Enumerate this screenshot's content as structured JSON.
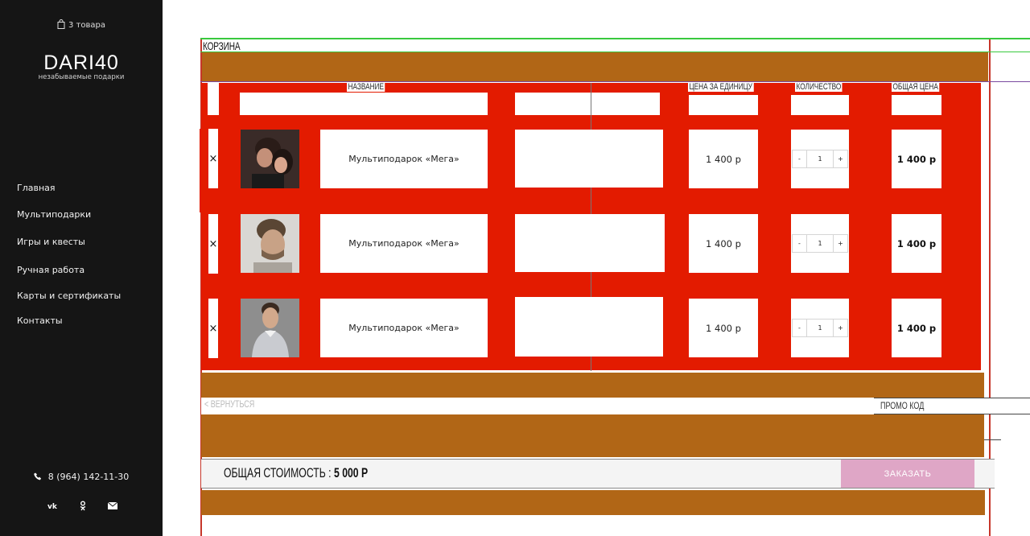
{
  "sidebar": {
    "cart_count": "3 товара",
    "logo": "DARI40",
    "tagline": "незабываемые подарки",
    "nav": [
      {
        "label": "Главная"
      },
      {
        "label": "Мультиподарки"
      },
      {
        "label": "Игры и квесты"
      },
      {
        "label": "Ручная работа"
      },
      {
        "label": "Карты и сертификаты"
      },
      {
        "label": "Контакты"
      }
    ],
    "phone": "8 (964) 142-11-30",
    "socials": [
      "vk-icon",
      "odnoklassniki-icon",
      "mail-icon"
    ]
  },
  "cart": {
    "title": "КОРЗИНА",
    "headers": {
      "name": "НАЗВАНИЕ",
      "unit_price": "ЦЕНА ЗА ЕДИНИЦУ",
      "quantity": "КОЛИЧЕСТВО",
      "total": "ОБЩАЯ ЦЕНА"
    },
    "items": [
      {
        "remove": "×",
        "name": "Мультиподарок «Мега»",
        "price": "1 400 р",
        "qty_minus": "-",
        "qty": "1",
        "qty_plus": "+",
        "total": "1 400 р"
      },
      {
        "remove": "×",
        "name": "Мультиподарок «Мега»",
        "price": "1 400 р",
        "qty_minus": "-",
        "qty": "1",
        "qty_plus": "+",
        "total": "1 400 р"
      },
      {
        "remove": "×",
        "name": "Мультиподарок «Мега»",
        "price": "1 400 р",
        "qty_minus": "-",
        "qty": "1",
        "qty_plus": "+",
        "total": "1 400 р"
      }
    ],
    "back_label": "< ВЕРНУТЬСЯ",
    "promo_label": "ПРОМО КОД",
    "sum_label": "ОБЩАЯ СТОИМОСТЬ : ",
    "sum_value": "5 000 Р",
    "order_label": "ЗАКАЗАТЬ"
  },
  "colors": {
    "sidebar_bg": "#151515",
    "overlay_brown": "#b16616",
    "overlay_red": "#e31b00",
    "order_button": "#dfa6c6"
  }
}
